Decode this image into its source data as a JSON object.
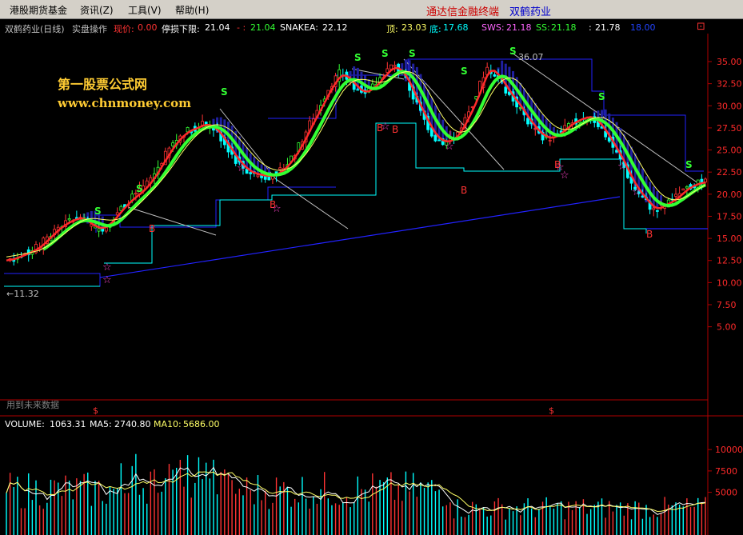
{
  "menu": {
    "items": [
      "港股期货基金",
      "资讯(Z)",
      "工具(V)",
      "帮助(H)"
    ],
    "title_left": "通达信金融终端",
    "title_right": "双鹤药业"
  },
  "header": {
    "stock": "双鹤药业(日线)",
    "formula": "实盘操作",
    "price_label": "现价:",
    "price_value": "0.00",
    "stop_label": "停损下限:",
    "stop_value": "21.04",
    "dash_label": "- :",
    "dash_value": "21.04",
    "snakea_label": "SNAKEA:",
    "snakea_value": "22.12",
    "top_label": "顶:",
    "top_value": "23.03",
    "bottom_label": "底:",
    "bottom_value": "17.68",
    "sws_label": "SWS:",
    "sws_value": "21.18",
    "ss_label": "SS:",
    "ss_value": "21.18",
    "extra1_label": ":",
    "extra1_value": "21.78",
    "extra2_value": "18.00",
    "corner_mark": "⊡"
  },
  "watermark": {
    "line1": "第一股票公式网",
    "line2": "www.chnmoney.com"
  },
  "price_axis": {
    "ticks": [
      "35.00",
      "32.50",
      "30.00",
      "27.50",
      "25.00",
      "22.50",
      "20.00",
      "17.50",
      "15.00",
      "12.50",
      "10.00",
      "7.50",
      "5.00"
    ]
  },
  "annotations": {
    "high_label": "36.07",
    "low_label": "←11.32",
    "future_data": "用到未来数据",
    "dollar_1": "$",
    "dollar_2": "$",
    "mark_buy": "B",
    "mark_sell": "S",
    "mark_star": "☆"
  },
  "volume": {
    "label": "VOLUME:",
    "value": "1063.31",
    "ma5_label": "MA5:",
    "ma5_value": "2740.80",
    "ma10_label": "MA10:",
    "ma10_value": "5686.00",
    "ticks": [
      "10000",
      "7500",
      "5000"
    ]
  },
  "colors": {
    "up": "#ff3333",
    "down": "#00ffff",
    "grid": "#b00000",
    "green_line": "#33ff33",
    "yellow_line": "#ffff66",
    "blue_line": "#2222ff",
    "fill_band": "#2020a0"
  },
  "chart_data": {
    "type": "candlestick",
    "y_range": [
      0,
      37.5
    ],
    "high": 36.07,
    "low": 11.32,
    "closes": [
      12.5,
      12.9,
      13.4,
      14.0,
      15.2,
      16.3,
      17.0,
      17.4,
      16.5,
      16.0,
      17.0,
      18.5,
      19.6,
      20.5,
      22.0,
      24.0,
      25.8,
      27.0,
      27.5,
      28.0,
      27.3,
      25.6,
      23.8,
      22.6,
      22.2,
      22.0,
      22.4,
      23.6,
      25.4,
      27.8,
      30.0,
      32.3,
      33.8,
      32.6,
      31.4,
      32.0,
      33.4,
      34.6,
      33.5,
      31.0,
      28.5,
      26.4,
      25.8,
      26.5,
      28.6,
      31.2,
      34.4,
      33.4,
      31.5,
      30.0,
      28.2,
      26.8,
      26.2,
      27.0,
      28.0,
      28.6,
      28.8,
      27.5,
      25.6,
      23.5,
      21.0,
      19.5,
      18.2,
      18.8,
      19.5,
      20.6,
      21.2,
      21.4
    ]
  }
}
